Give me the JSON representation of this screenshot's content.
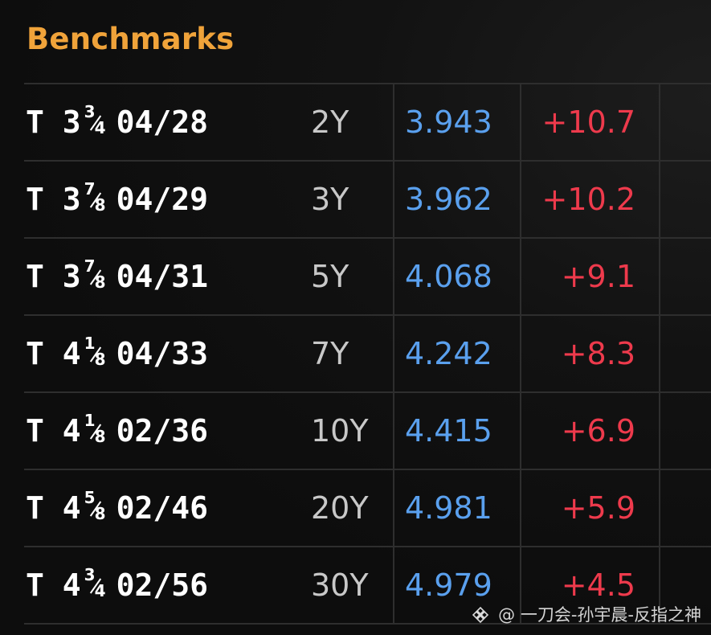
{
  "header": {
    "title": "Benchmarks"
  },
  "colors": {
    "title": "#f0a33a",
    "security": "#ffffff",
    "tenor": "#c8c8c8",
    "yield": "#5aa0ee",
    "change": "#ee3a4c",
    "grid": "#2e2e2e"
  },
  "rows": [
    {
      "prefix": "T 3",
      "frac_num": "3",
      "frac_den": "4",
      "maturity": "04/28",
      "tenor": "2Y",
      "yield": "3.943",
      "change": "+10.7"
    },
    {
      "prefix": "T 3",
      "frac_num": "7",
      "frac_den": "8",
      "maturity": "04/29",
      "tenor": "3Y",
      "yield": "3.962",
      "change": "+10.2"
    },
    {
      "prefix": "T 3",
      "frac_num": "7",
      "frac_den": "8",
      "maturity": "04/31",
      "tenor": "5Y",
      "yield": "4.068",
      "change": "+9.1"
    },
    {
      "prefix": "T 4",
      "frac_num": "1",
      "frac_den": "8",
      "maturity": "04/33",
      "tenor": "7Y",
      "yield": "4.242",
      "change": "+8.3"
    },
    {
      "prefix": "T 4",
      "frac_num": "1",
      "frac_den": "8",
      "maturity": "02/36",
      "tenor": "10Y",
      "yield": "4.415",
      "change": "+6.9"
    },
    {
      "prefix": "T 4",
      "frac_num": "5",
      "frac_den": "8",
      "maturity": "02/46",
      "tenor": "20Y",
      "yield": "4.981",
      "change": "+5.9"
    },
    {
      "prefix": "T 4",
      "frac_num": "3",
      "frac_den": "4",
      "maturity": "02/56",
      "tenor": "30Y",
      "yield": "4.979",
      "change": "+4.5"
    }
  ],
  "watermark": {
    "text": "@ 一刀会-孙宇晨-反指之神",
    "icon": "diamond-logo-icon"
  }
}
